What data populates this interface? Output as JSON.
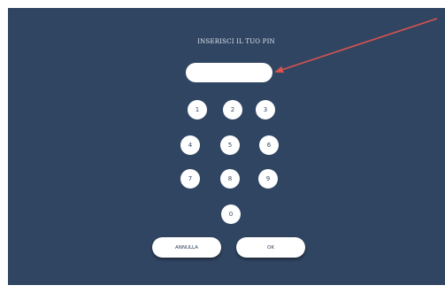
{
  "pin_screen": {
    "title": "INSERISCI IL TUO PIN",
    "pin_value": ""
  },
  "keypad": {
    "keys": [
      "1",
      "2",
      "3",
      "4",
      "5",
      "6",
      "7",
      "8",
      "9",
      "0"
    ]
  },
  "actions": {
    "cancel_label": "ANNULLA",
    "ok_label": "OK"
  },
  "colors": {
    "background": "#304562",
    "field": "#ffffff",
    "annotation_arrow": "#d9534f"
  }
}
